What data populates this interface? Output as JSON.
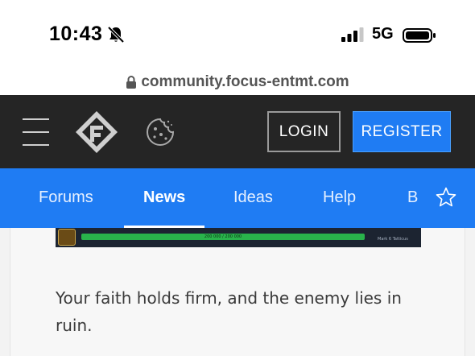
{
  "status": {
    "time": "10:43",
    "network": "5G",
    "icons": [
      "bell-slash-icon",
      "signal-icon",
      "battery-icon"
    ]
  },
  "browser": {
    "url": "community.focus-entmt.com",
    "lock_icon": "lock-icon"
  },
  "header": {
    "login_label": "LOGIN",
    "register_label": "REGISTER",
    "colors": {
      "background": "#252525",
      "accent": "#1f7cf3"
    },
    "icons": [
      "menu-icon",
      "site-logo",
      "cookie-icon"
    ]
  },
  "nav": {
    "tabs": [
      {
        "label": "Forums",
        "active": false
      },
      {
        "label": "News",
        "active": true
      },
      {
        "label": "Ideas",
        "active": false
      },
      {
        "label": "Help",
        "active": false
      },
      {
        "label": "B",
        "active": false
      }
    ],
    "star_icon": "star-outline-icon",
    "color": "#1f7cf3"
  },
  "content": {
    "banner": {
      "hp_text": "200 000 / 200 000",
      "tag_text": "Mark 6 Tatticus",
      "bar_fill": 1.0,
      "bar_color": "#29b34b"
    },
    "paragraph": "Your faith holds firm, and the enemy lies in ruin."
  }
}
